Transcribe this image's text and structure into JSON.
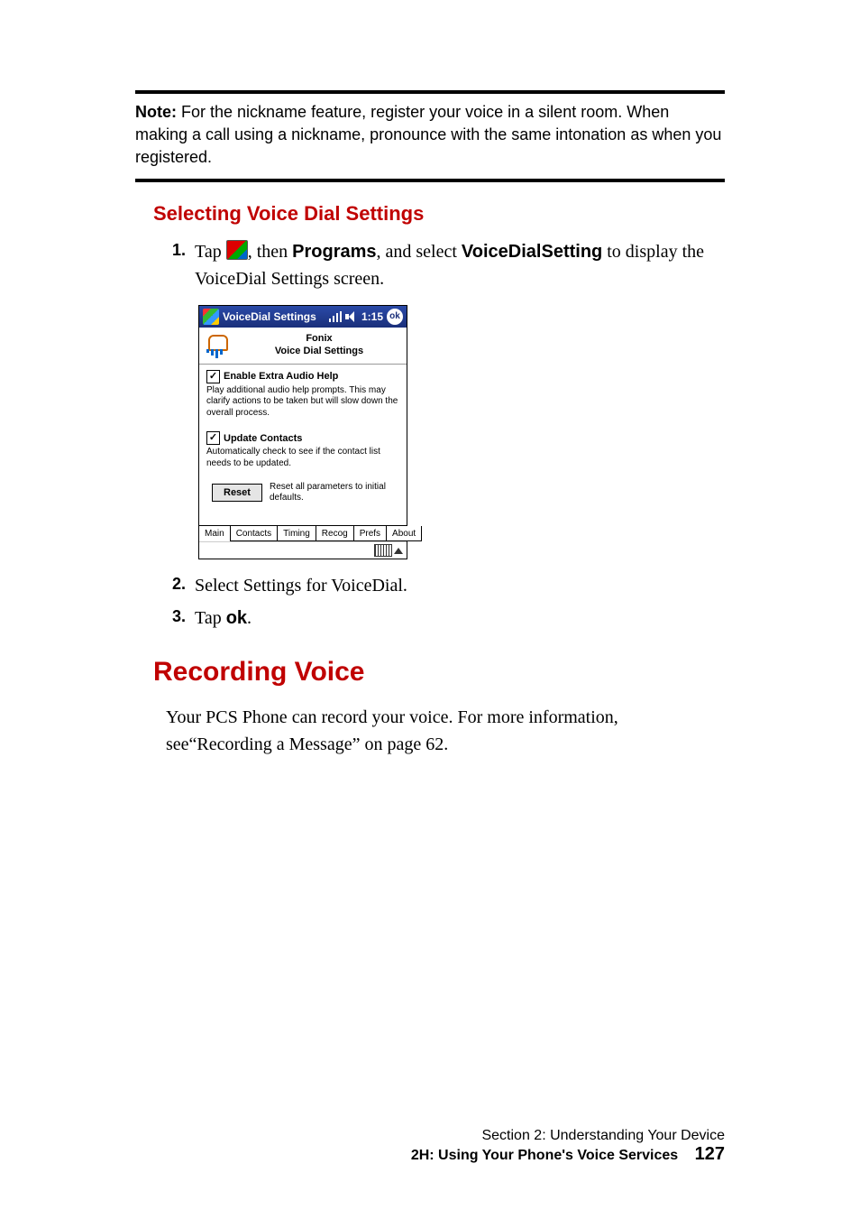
{
  "note": {
    "label": "Note:",
    "text": " For the nickname feature, register your voice in a silent room. When making a call using a nickname, pronounce with the same intonation as when you registered."
  },
  "section_heading": "Selecting Voice Dial Settings",
  "step1": {
    "num": "1.",
    "pre": "Tap ",
    "mid1": ", then ",
    "bold1": "Programs",
    "mid2": ", and select ",
    "bold2": "VoiceDialSetting",
    "mid3": " to display the VoiceDial Settings screen."
  },
  "ppc": {
    "title": "VoiceDial Settings",
    "time": "1:15",
    "ok": "ok",
    "brand": "Fonix",
    "subtitle": "Voice Dial Settings",
    "opt1_label": "Enable Extra Audio Help",
    "opt1_desc": "Play additional audio help prompts. This may clarify actions to be taken but will slow down the overall process.",
    "opt2_label": "Update Contacts",
    "opt2_desc": "Automatically check to see if the contact list needs to be updated.",
    "reset_btn": "Reset",
    "reset_desc": "Reset all parameters to initial defaults.",
    "tabs": [
      "Main",
      "Contacts",
      "Timing",
      "Recog",
      "Prefs",
      "About"
    ],
    "chk_mark": "✓"
  },
  "step2": {
    "num": "2.",
    "text": "Select Settings for VoiceDial."
  },
  "step3": {
    "num": "3.",
    "pre": "Tap ",
    "bold": "ok",
    "post": "."
  },
  "h2": "Recording Voice",
  "para": "Your PCS Phone can record your voice. For more information, see“Recording a Message” on page 62.",
  "footer": {
    "line1": "Section 2: Understanding Your Device",
    "line2": "2H: Using Your Phone's Voice Services",
    "page": "127"
  }
}
